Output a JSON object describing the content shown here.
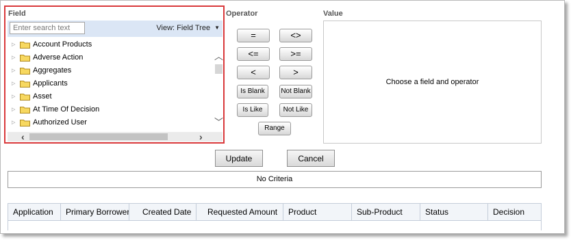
{
  "field_panel": {
    "title": "Field",
    "search_placeholder": "Enter search text",
    "view_select": "View: Field Tree",
    "tree_items": [
      {
        "label": "Account Products",
        "icon": "folder-icon"
      },
      {
        "label": "Adverse Action",
        "icon": "folder-icon"
      },
      {
        "label": "Aggregates",
        "icon": "folder-icon"
      },
      {
        "label": "Applicants",
        "icon": "folder-icon"
      },
      {
        "label": "Asset",
        "icon": "folder-icon"
      },
      {
        "label": "At Time Of Decision",
        "icon": "folder-icon"
      },
      {
        "label": "Authorized User",
        "icon": "folder-icon"
      }
    ]
  },
  "operator_panel": {
    "title": "Operator",
    "buttons": [
      "=",
      "<>",
      "<=",
      ">=",
      "<",
      ">",
      "Is Blank",
      "Not Blank",
      "Is Like",
      "Not Like",
      "Range"
    ]
  },
  "value_panel": {
    "title": "Value",
    "message": "Choose a field and operator"
  },
  "actions": {
    "update_label": "Update",
    "cancel_label": "Cancel"
  },
  "criteria": {
    "text": "No Criteria"
  },
  "results_table": {
    "columns": [
      "Application",
      "Primary Borrower",
      "Created Date",
      "Requested Amount",
      "Product",
      "Sub-Product",
      "Status",
      "Decision"
    ]
  },
  "colors": {
    "highlight_border": "#d9383a",
    "tree_header_bg": "#dbe6f5",
    "folder_fill": "#f7d860"
  }
}
